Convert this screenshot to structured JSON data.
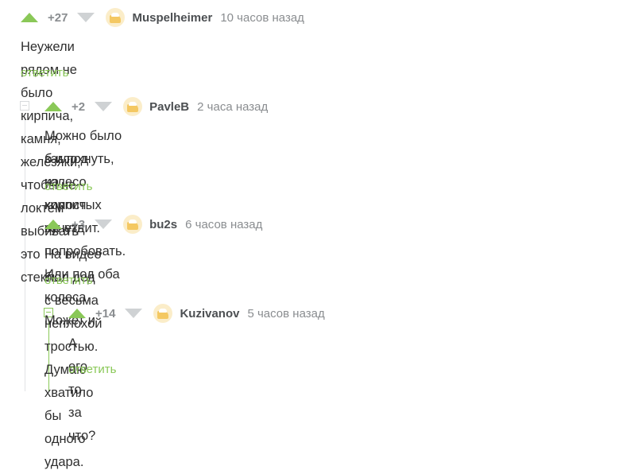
{
  "comments": [
    {
      "rating": "+27",
      "author": "Muspelheimer",
      "time": "10 часов назад",
      "text": "Неужели рядом не было кирпича, камня, железяки, чтобы не локтем выбивать это стекло",
      "reply_label": "ответить"
    },
    {
      "rating": "+2",
      "author": "PavleB",
      "time": "2 часа назад",
      "text_line1": "Можно было б и под колесо кирпич сунуть попробовать. Или под оба колеса. Может и",
      "text_line2": "заглохнуть, на холостых же ездит.",
      "reply_label": "ответить"
    },
    {
      "rating": "+3",
      "author": "bu2s",
      "time": "6 часов назад",
      "text": "На видео был дед с весьма неплохой тростью. Думаю хватило бы одного удара.",
      "reply_label": "ответить"
    },
    {
      "rating": "+14",
      "author": "Kuzivanov",
      "time": "5 часов назад",
      "text": "А его то за что?",
      "reply_label": "ответить"
    }
  ],
  "icons": {
    "upvote": "arrow-up-icon",
    "downvote": "arrow-down-icon",
    "avatar": "pie-avatar-icon",
    "collapse": "collapse-minus-icon"
  },
  "colors": {
    "accent": "#8ac858",
    "vote_down": "#cfd2d4",
    "meta": "#8a8d90",
    "author": "#4c4f52",
    "text": "#2f2f2f"
  }
}
